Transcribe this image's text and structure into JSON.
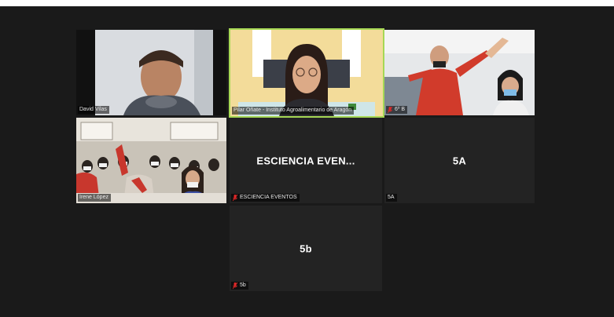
{
  "meeting": {
    "tiles": [
      {
        "id": "david",
        "name": "David Vilas",
        "type": "video",
        "muted": false
      },
      {
        "id": "pilar",
        "name": "Pilar Oñate - Instituto Agroalimentario de Aragón",
        "type": "video",
        "muted": false,
        "speaking": true
      },
      {
        "id": "6b",
        "name": "6º B",
        "type": "video",
        "muted": true
      },
      {
        "id": "irene",
        "name": "Irene López",
        "type": "video",
        "muted": false
      },
      {
        "id": "escienc",
        "name": "ESCIENCIA EVENTOS",
        "center_label": "ESCIENCIA  EVEN...",
        "type": "avatar",
        "muted": true
      },
      {
        "id": "5a",
        "name": "5A",
        "center_label": "5A",
        "type": "avatar",
        "muted": false
      },
      {
        "id": "5b",
        "name": "5b",
        "center_label": "5b",
        "type": "avatar",
        "muted": true
      }
    ],
    "colors": {
      "speaking_border": "#a6d854",
      "muted_icon": "#e02828",
      "tile_bg": "#232323",
      "page_bg": "#1a1a1a"
    }
  }
}
